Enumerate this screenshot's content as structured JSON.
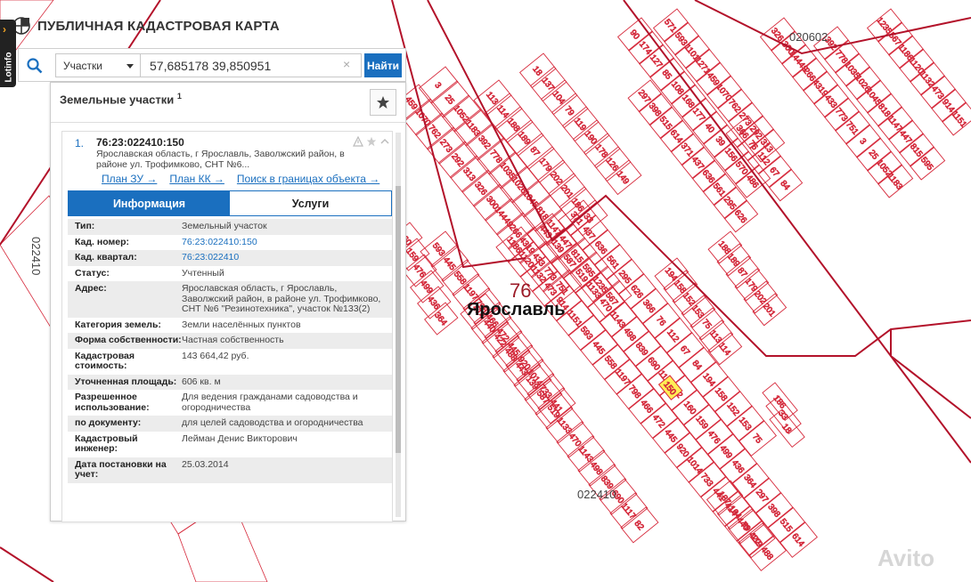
{
  "app": {
    "title": "ПУБЛИЧНАЯ КАДАСТРОВАЯ КАРТА",
    "side_tab": "Lotinfo"
  },
  "search": {
    "type_label": "Участки",
    "query": "57,685178 39,850951",
    "clear": "×",
    "button_label": "Найти"
  },
  "panel": {
    "title": "Земельные участки",
    "count": "1",
    "result": {
      "index": "1.",
      "code": "76:23:022410:150",
      "address_short": "Ярославская область, г Ярославль, Заволжский район, в районе ул. Трофимково, СНТ №6...",
      "links": [
        "План ЗУ →",
        "План КК →",
        "Поиск в границах объекта →"
      ]
    },
    "tabs": {
      "info": "Информация",
      "services": "Услуги"
    },
    "info": [
      {
        "key": "Тип:",
        "value": "Земельный участок",
        "link": false
      },
      {
        "key": "Кад. номер:",
        "value": "76:23:022410:150",
        "link": true
      },
      {
        "key": "Кад. квартал:",
        "value": "76:23:022410",
        "link": true
      },
      {
        "key": "Статус:",
        "value": "Учтенный",
        "link": false
      },
      {
        "key": "Адрес:",
        "value": "Ярославская область, г Ярославль, Заволжский район, в районе ул. Трофимково, СНТ №6 \"Резинотехника\", участок №133(2)",
        "link": false
      },
      {
        "key": "Категория земель:",
        "value": "Земли населённых пунктов",
        "link": false
      },
      {
        "key": "Форма собственности:",
        "value": "Частная собственность",
        "link": false
      },
      {
        "key": "Кадастровая стоимость:",
        "value": "143 664,42 руб.",
        "link": false
      },
      {
        "key": "Уточненная площадь:",
        "value": "606 кв. м",
        "link": false
      },
      {
        "key": "Разрешенное использование:",
        "value": "Для ведения гражданами садоводства и огородничества",
        "link": false
      },
      {
        "key": "по документу:",
        "value": "для целей садоводства и огородничества",
        "link": false
      },
      {
        "key": "Кадастровый инженер:",
        "value": "Лейман Денис Викторович",
        "link": false
      },
      {
        "key": "Дата постановки на учет:",
        "value": "25.03.2014",
        "link": false
      }
    ]
  },
  "map": {
    "region_number": "76",
    "city": "Ярославль",
    "quarter_labels": [
      "022410",
      "020602",
      "022410"
    ],
    "selected_parcel": "150",
    "parcels": [
      "459",
      "1070",
      "762",
      "273",
      "292",
      "313",
      "326",
      "300",
      "14449",
      "266",
      "4319",
      "433",
      "773",
      "751",
      "3",
      "25",
      "1052",
      "1183",
      "392",
      "778",
      "1035",
      "1026",
      "1045",
      "818",
      "1147",
      "447",
      "815",
      "595",
      "1235",
      "567",
      "1186",
      "1120",
      "1132",
      "473",
      "914",
      "1151",
      "593",
      "445",
      "558",
      "1197",
      "798",
      "466",
      "472",
      "445",
      "920",
      "1014",
      "733",
      "441",
      "414",
      "440",
      "422",
      "488",
      "443",
      "139",
      "587",
      "519",
      "1133",
      "470",
      "1143",
      "498",
      "839",
      "690",
      "1117",
      "82",
      "160",
      "159",
      "476",
      "499",
      "436",
      "364",
      "297",
      "398",
      "515",
      "614",
      "371",
      "437",
      "636",
      "561",
      "295",
      "626",
      "366",
      "76",
      "112",
      "67",
      "84",
      "194",
      "158",
      "152",
      "153",
      "75",
      "113",
      "114",
      "188",
      "189",
      "87",
      "179",
      "202",
      "201",
      "186",
      "33",
      "18",
      "137",
      "104",
      "79",
      "119",
      "190",
      "178",
      "126",
      "149",
      "90",
      "174",
      "127",
      "85",
      "108",
      "168",
      "177",
      "40",
      "39",
      "156",
      "570",
      "486",
      "571",
      "593",
      "1101",
      "1271"
    ],
    "watermark": "Avito"
  },
  "colors": {
    "accent": "#1a6fbf",
    "parcel_line": "#d6293b",
    "selected_fill": "#ffee55"
  }
}
